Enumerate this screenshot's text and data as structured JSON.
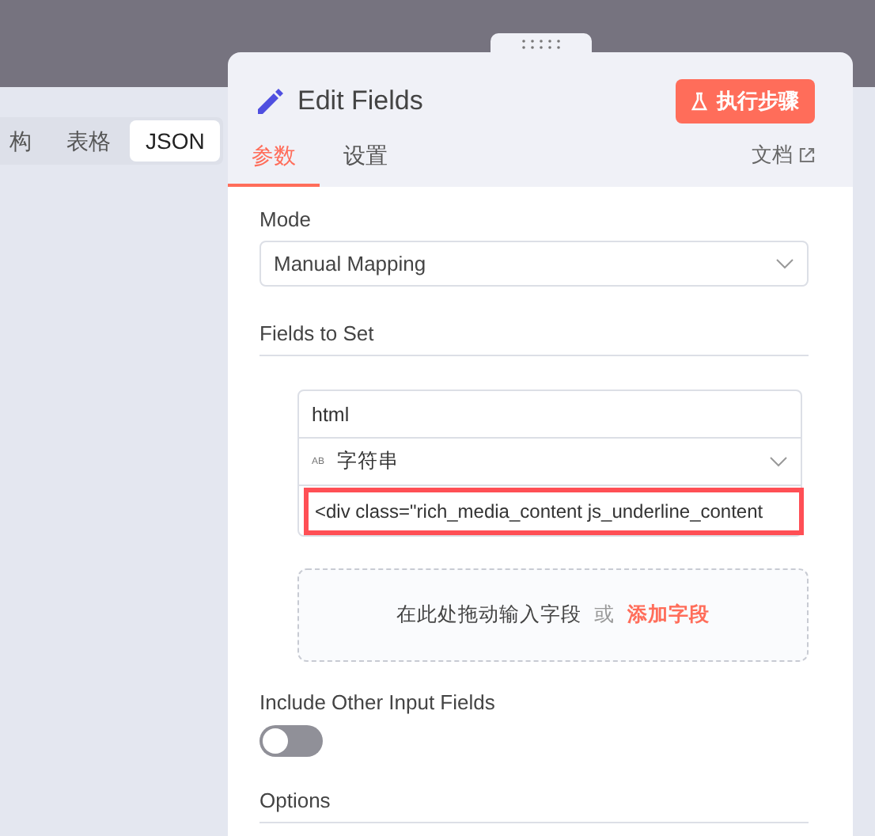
{
  "background_tabs": [
    {
      "label": "构",
      "selected": false
    },
    {
      "label": "表格",
      "selected": false
    },
    {
      "label": "JSON",
      "selected": true
    }
  ],
  "panel": {
    "title": "Edit Fields",
    "run_button": "执行步骤",
    "tabs": [
      {
        "label": "参数",
        "selected": true
      },
      {
        "label": "设置",
        "selected": false
      }
    ],
    "docs_link": "文档",
    "mode": {
      "label": "Mode",
      "value": "Manual Mapping"
    },
    "fields_to_set": {
      "label": "Fields to Set",
      "fields": [
        {
          "name": "html",
          "type_badge": "AB",
          "type": "字符串",
          "value": "<div class=\"rich_media_content js_underline_content",
          "highlighted": true
        }
      ],
      "drop_hint": "在此处拖动输入字段",
      "drop_or": "或",
      "add_field": "添加字段"
    },
    "include_other": {
      "label": "Include Other Input Fields",
      "on": false
    },
    "options": {
      "label": "Options"
    }
  }
}
